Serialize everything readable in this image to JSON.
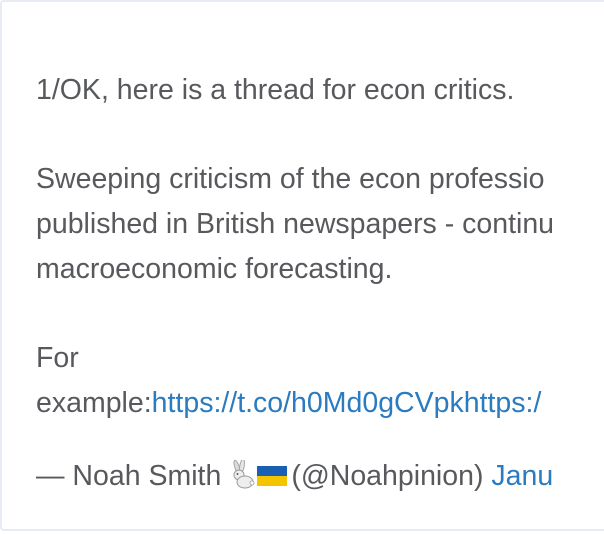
{
  "tweet": {
    "paragraph_1": "1/OK, here is a thread for econ critics.",
    "paragraph_2_line_1": "Sweeping criticism of the econ professio",
    "paragraph_2_line_2": "published in British newspapers - continu",
    "paragraph_2_line_3": "macroeconomic forecasting.",
    "paragraph_3_line_1": "For",
    "paragraph_3_prefix": "example:",
    "links_text": "https://t.co/h0Md0gCVpkhttps:/",
    "attribution_dash": "— Noah Smith",
    "author_emoji": [
      "rabbit-icon",
      "ukraine-flag-icon"
    ],
    "author_handle": "(@Noahpinion)",
    "date_link": "Janu"
  },
  "colors": {
    "text": "#57595d",
    "link": "#2b7bc0",
    "border": "#e6ecf2"
  }
}
